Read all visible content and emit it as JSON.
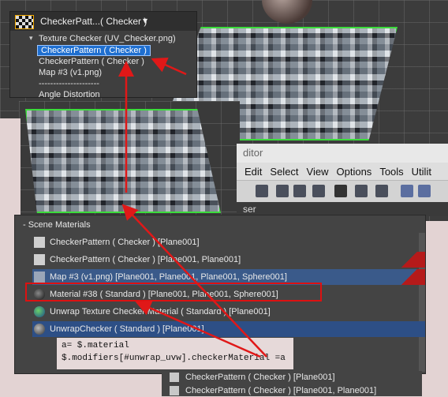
{
  "dropdown": {
    "current": "CheckerPatt...( Checker )",
    "arrow": "▾",
    "items": [
      "Texture Checker (UV_Checker.png)",
      "CheckerPattern  ( Checker )",
      "CheckerPattern  ( Checker )",
      "Map #3 (v1.png)",
      "---------------------",
      "Angle Distortion"
    ]
  },
  "editor": {
    "title_fragment": "ditor",
    "menu": [
      "Edit",
      "Select",
      "View",
      "Options",
      "Tools",
      "Utilit"
    ],
    "subheader": "ser"
  },
  "scene_materials": {
    "header": "- Scene Materials",
    "rows": [
      {
        "label": "CheckerPattern  ( Checker ) [Plane001]",
        "swatch": "#cfcfcf",
        "highlight": false
      },
      {
        "label": "CheckerPattern  ( Checker ) [Plane001, Plane001]",
        "swatch": "#cfcfcf",
        "highlight": false
      },
      {
        "label": "Map #3 (v1.png)  [Plane001, Plane001, Plane001, Sphere001]",
        "swatch": "#9aa6b8",
        "highlight": true
      },
      {
        "label": "Material #38  ( Standard ) [Plane001, Plane001, Sphere001]",
        "swatch": "#2a2a2a",
        "highlight": false
      },
      {
        "label": "Unwrap Texture Checker Material  ( Standard ) [Plane001]",
        "swatch": "#2f7a35",
        "highlight": false
      },
      {
        "label": "UnwrapChecker  ( Standard ) [Plane001]",
        "swatch": "#888888",
        "highlight": true
      }
    ]
  },
  "code": {
    "line1": "a= $.material",
    "line2": "$.modifiers[#unwrap_uvw].checkerMaterial =a"
  },
  "bottom_list": [
    "CheckerPattern  ( Checker ) [Plane001]",
    "CheckerPattern  ( Checker ) [Plane001, Plane001]"
  ],
  "colors": {
    "highlight_box": "#d11111",
    "arrow": "#e01818",
    "selection_green": "#3cdc3c",
    "menu_highlight": "#1f6fd0"
  }
}
